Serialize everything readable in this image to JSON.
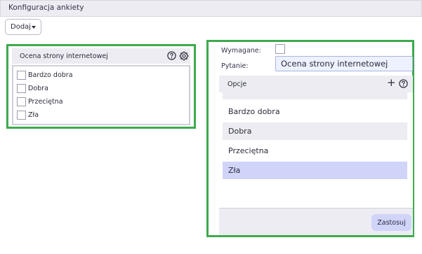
{
  "window": {
    "title": "Konfiguracja ankiety"
  },
  "toolbar": {
    "add_label": "Dodaj"
  },
  "question_preview": {
    "title": "Ocena strony internetowej",
    "options": [
      "Bardzo dobra",
      "Dobra",
      "Przeciętna",
      "Zła"
    ]
  },
  "editor": {
    "required_label": "Wymagane:",
    "question_label": "Pytanie:",
    "question_value": "Ocena strony internetowej",
    "options_header": "Opcje",
    "options": [
      "Bardzo dobra",
      "Dobra",
      "Przeciętna",
      "Zła"
    ],
    "apply_label": "Zastosuj"
  },
  "colors": {
    "highlight_border": "#3daa4e",
    "selected_option": "#d0d4f9",
    "panel_gray": "#ececf2"
  },
  "icons": {
    "help": "help-circle-icon",
    "settings": "gear-icon",
    "add": "plus-icon",
    "dropdown": "caret-down-icon"
  }
}
